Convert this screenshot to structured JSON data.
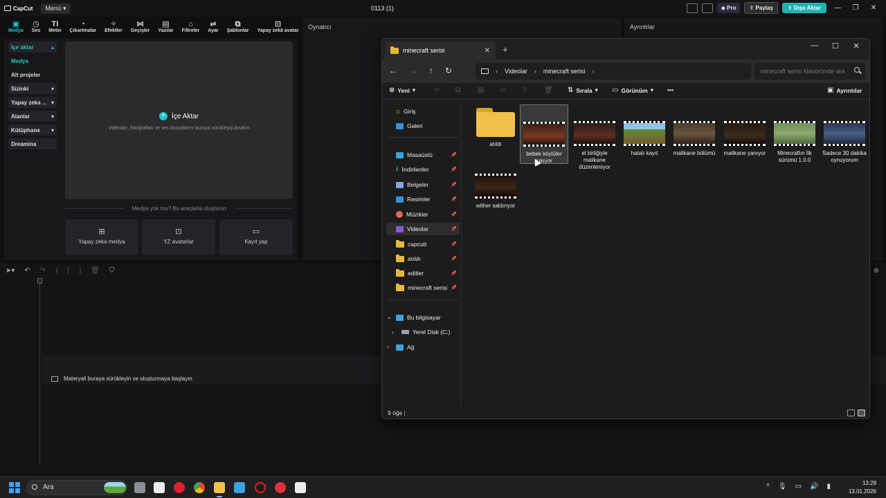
{
  "capcut": {
    "logo": "CapCut",
    "menu_label": "Menü",
    "project_title": "0113 (1)",
    "pro_label": "Pro",
    "share_label": "Paylaş",
    "export_label": "Dışa Aktar",
    "tools": [
      {
        "label": "Medya",
        "icon": "media-icon"
      },
      {
        "label": "Ses",
        "icon": "audio-icon"
      },
      {
        "label": "Metin",
        "icon": "text-icon"
      },
      {
        "label": "Çıkartmalar",
        "icon": "sticker-icon"
      },
      {
        "label": "Efektler",
        "icon": "effects-icon"
      },
      {
        "label": "Geçişler",
        "icon": "transitions-icon"
      },
      {
        "label": "Yazılar",
        "icon": "captions-icon"
      },
      {
        "label": "Filtreler",
        "icon": "filters-icon"
      },
      {
        "label": "Ayar",
        "icon": "adjust-icon"
      },
      {
        "label": "Şablonlar",
        "icon": "templates-icon"
      },
      {
        "label": "Yapay zekâ avatar",
        "icon": "ai-avatar-icon"
      }
    ],
    "sidebar": [
      {
        "label": "İçe aktar"
      },
      {
        "label": "Medya"
      },
      {
        "label": "Alt projeler"
      },
      {
        "label": "Sizinki"
      },
      {
        "label": "Yapay zeka ..."
      },
      {
        "label": "Alanlar"
      },
      {
        "label": "Kütüphane"
      },
      {
        "label": "Dreamina"
      }
    ],
    "import": {
      "title": "İçe Aktar",
      "subtitle": "Videoları, fotoğrafları ve ses dosyalarını buraya sürükleyip bırakın"
    },
    "generate_label": "Medya yok mu? Bu araçlarla oluşturun",
    "generate_buttons": [
      {
        "label": "Yapay zeka medya"
      },
      {
        "label": "YZ avatarlar"
      },
      {
        "label": "Kayıt yap"
      }
    ],
    "player_title": "Oynatıcı",
    "details_title": "Ayrıntılar",
    "timeline_hint": "Materyali buraya sürükleyin ve oluşturmaya başlayın"
  },
  "explorer": {
    "tab_title": "minecraft serisi",
    "breadcrumb": [
      "Videolar",
      "minecraft serisi"
    ],
    "search_placeholder": "minecraft serisi klasöründe ara",
    "commands": {
      "new": "Yeni",
      "sort": "Sırala",
      "view": "Görünüm",
      "details": "Ayrıntılar"
    },
    "nav": {
      "top": [
        "Giriş",
        "Galeri"
      ],
      "pinned": [
        "Masaüstü",
        "İndirilenler",
        "Belgeler",
        "Resimler",
        "Müzikler",
        "Videolar",
        "capcutt",
        "atıldı",
        "editler",
        "minecraft serisi"
      ],
      "this_pc": "Bu bilgisayar",
      "local_disk": "Yerel Disk (C:)",
      "network": "Ağ"
    },
    "files": [
      {
        "name": "atıldı",
        "kind": "folder"
      },
      {
        "name": "bebek köylüler çıkıyor",
        "kind": "video"
      },
      {
        "name": "el birliğiyle malikane düzenleniyor",
        "kind": "video"
      },
      {
        "name": "hatalı kayıt",
        "kind": "video"
      },
      {
        "name": "malikane bölümü",
        "kind": "video"
      },
      {
        "name": "malikane yanıyor",
        "kind": "video"
      },
      {
        "name": "Minecraftın İlk sürümü 1.0.0",
        "kind": "video"
      },
      {
        "name": "Sadece 30 dakika oynuyorum",
        "kind": "video"
      },
      {
        "name": "wither saldırıyor",
        "kind": "video"
      }
    ],
    "status": "9 öğe"
  },
  "taskbar": {
    "search_label": "Ara",
    "time": "13:29",
    "date": "13.01.2026"
  }
}
